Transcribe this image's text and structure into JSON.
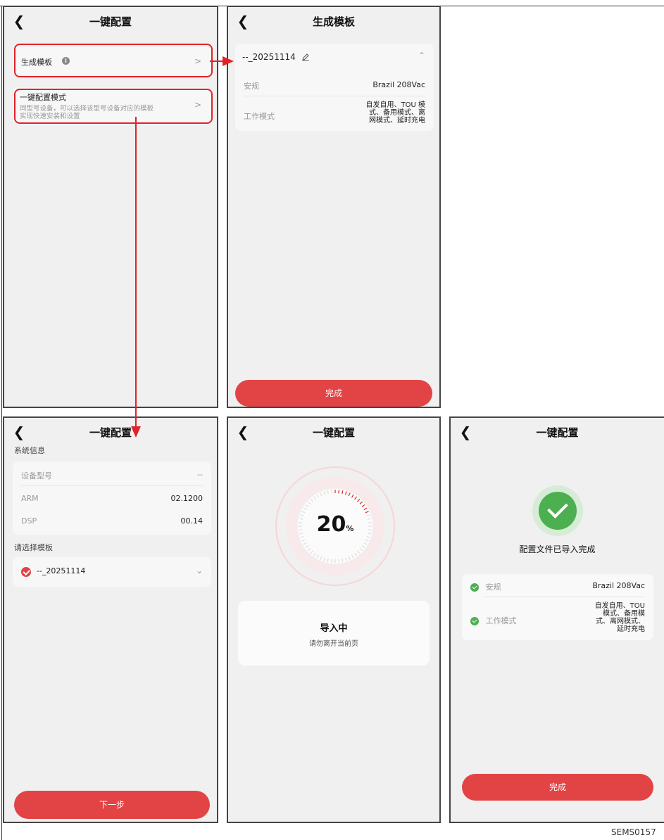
{
  "screen1": {
    "title": "一键配置",
    "item1_label": "生成模板",
    "item2_label": "一键配置模式",
    "item2_desc_line1": "同型号设备，可以选择该型号设备对应的模板",
    "item2_desc_line2": "实现快速安装和设置"
  },
  "screen2": {
    "title": "生成模板",
    "template_name": "--_20251114",
    "rows": [
      {
        "label": "安规",
        "value": "Brazil 208Vac"
      },
      {
        "label": "工作模式",
        "value_lines": [
          "自发自用、TOU 模",
          "式、备用模式、离",
          "网模式、延时充电"
        ]
      }
    ],
    "done_button": "完成"
  },
  "screen3": {
    "title": "一键配置",
    "section1": "系统信息",
    "rows": [
      {
        "label": "设备型号",
        "value": "--"
      },
      {
        "label": "ARM",
        "value": "02.1200"
      },
      {
        "label": "DSP",
        "value": "00.14"
      }
    ],
    "section2": "请选择模板",
    "selected_template": "--_20251114",
    "next_button": "下一步"
  },
  "screen4": {
    "title": "一键配置",
    "progress_value": "20",
    "progress_unit": "%",
    "progress_fraction": 0.2,
    "status_title": "导入中",
    "status_sub": "请勿离开当前页"
  },
  "screen5": {
    "title": "一键配置",
    "success_text": "配置文件已导入完成",
    "rows": [
      {
        "label": "安规",
        "value": "Brazil 208Vac"
      },
      {
        "label": "工作模式",
        "value_lines": [
          "自发自用、TOU",
          "模式、备用模",
          "式、离网模式、",
          "延时充电"
        ]
      }
    ],
    "done_button": "完成"
  },
  "figure_code": "SEMS0157",
  "colors": {
    "accent_red": "#e24446",
    "annotation_red": "#e0232a",
    "success_green": "#4caf50"
  },
  "icons": [
    "back-arrow-icon",
    "info-icon",
    "chevron-right-icon",
    "edit-pencil-icon",
    "chevron-up-icon",
    "chevron-down-icon",
    "check-circle-icon"
  ]
}
